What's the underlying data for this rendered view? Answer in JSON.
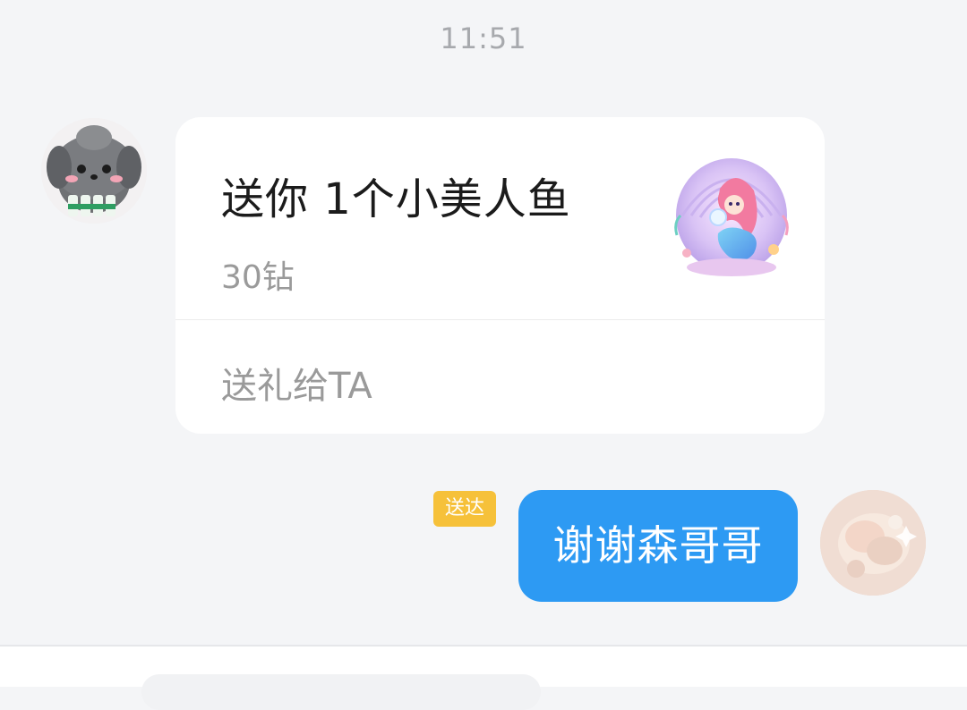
{
  "chat": {
    "timestamp": "11:51",
    "incoming": {
      "avatar_icon": "cartoon-gray-dog-avatar",
      "gift_card": {
        "title": "送你 1个小美人鱼",
        "price": "30钻",
        "action_label": "送礼给TA",
        "gift_icon": "mermaid-gift-icon"
      }
    },
    "outgoing": {
      "status_badge": "送达",
      "text": "谢谢森哥哥",
      "avatar_icon": "user-avatar"
    }
  },
  "colors": {
    "background": "#f4f5f7",
    "outgoing_bubble": "#2d9af3",
    "badge": "#f6c13a"
  }
}
